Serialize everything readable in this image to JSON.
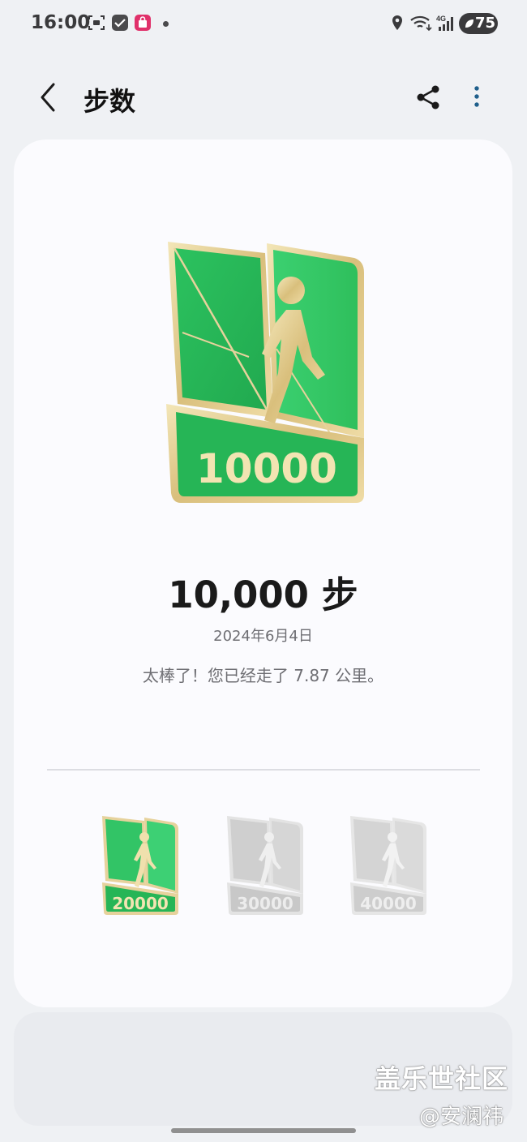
{
  "status_bar": {
    "time": "16:00",
    "battery": "75",
    "network": "4G",
    "icons": [
      "scan-icon",
      "checkbox-app-icon",
      "shopping-bag-app-icon",
      "notification-dot",
      "location-icon",
      "wifi-icon",
      "cellular-signal-icon",
      "battery-icon"
    ]
  },
  "app_bar": {
    "title": "步数",
    "back_icon": "chevron-left-icon",
    "share_icon": "share-icon",
    "more_icon": "more-vertical-icon"
  },
  "achievement": {
    "badge_number": "10000",
    "steps_text": "10,000 步",
    "date": "2024年6月4日",
    "message": "太棒了！您已经走了 7.87 公里。",
    "badge_color": "#2fbf5c",
    "badge_rim_color": "#e6d29c"
  },
  "next_badges": [
    {
      "number": "20000",
      "unlocked": true
    },
    {
      "number": "30000",
      "unlocked": false
    },
    {
      "number": "40000",
      "unlocked": false
    }
  ],
  "watermark": {
    "title": "盖乐世社区",
    "author": "@安澜祎"
  }
}
